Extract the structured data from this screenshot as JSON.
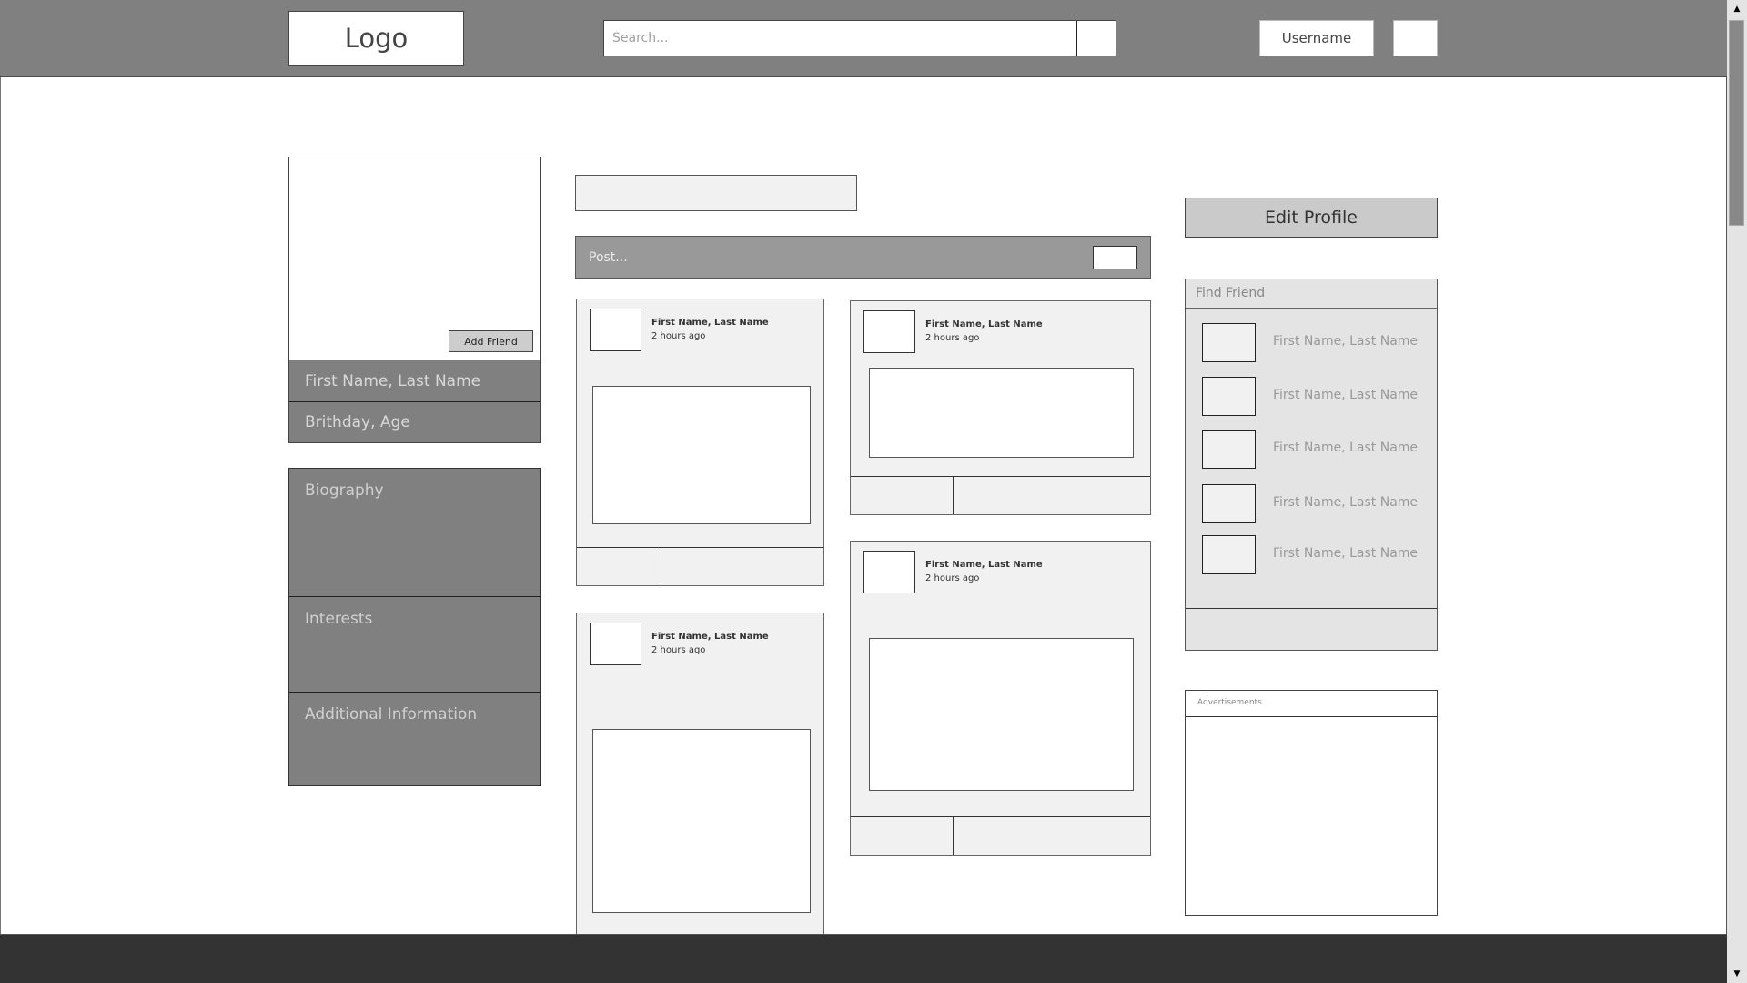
{
  "header": {
    "logo_text": "Logo",
    "search_placeholder": "Search...",
    "search_button_icon": "search-icon",
    "username_label": "Username",
    "menu_button_icon": "menu-icon"
  },
  "profile": {
    "add_friend_label": "Add Friend",
    "name": "First Name, Last Name",
    "birthday_age": "Brithday, Age",
    "sections": {
      "biography": "Biography",
      "interests": "Interests",
      "additional": "Additional Information"
    }
  },
  "feed": {
    "post_placeholder": "Post...",
    "posts": [
      {
        "author": "First Name, Last Name",
        "time": "2 hours ago"
      },
      {
        "author": "First Name, Last Name",
        "time": "2 hours ago"
      },
      {
        "author": "First Name, Last Name",
        "time": "2 hours ago"
      },
      {
        "author": "First Name, Last Name",
        "time": "2 hours ago"
      }
    ]
  },
  "sidebar": {
    "edit_profile_label": "Edit Profile",
    "find_friend": {
      "title": "Find Friend",
      "items": [
        {
          "name": "First Name, Last Name"
        },
        {
          "name": "First Name, Last Name"
        },
        {
          "name": "First Name, Last Name"
        },
        {
          "name": "First Name, Last Name"
        },
        {
          "name": "First Name, Last Name"
        }
      ]
    },
    "ads_title": "Advertisements"
  },
  "scrollbar": {
    "up_glyph": "▲",
    "down_glyph": "▼"
  }
}
